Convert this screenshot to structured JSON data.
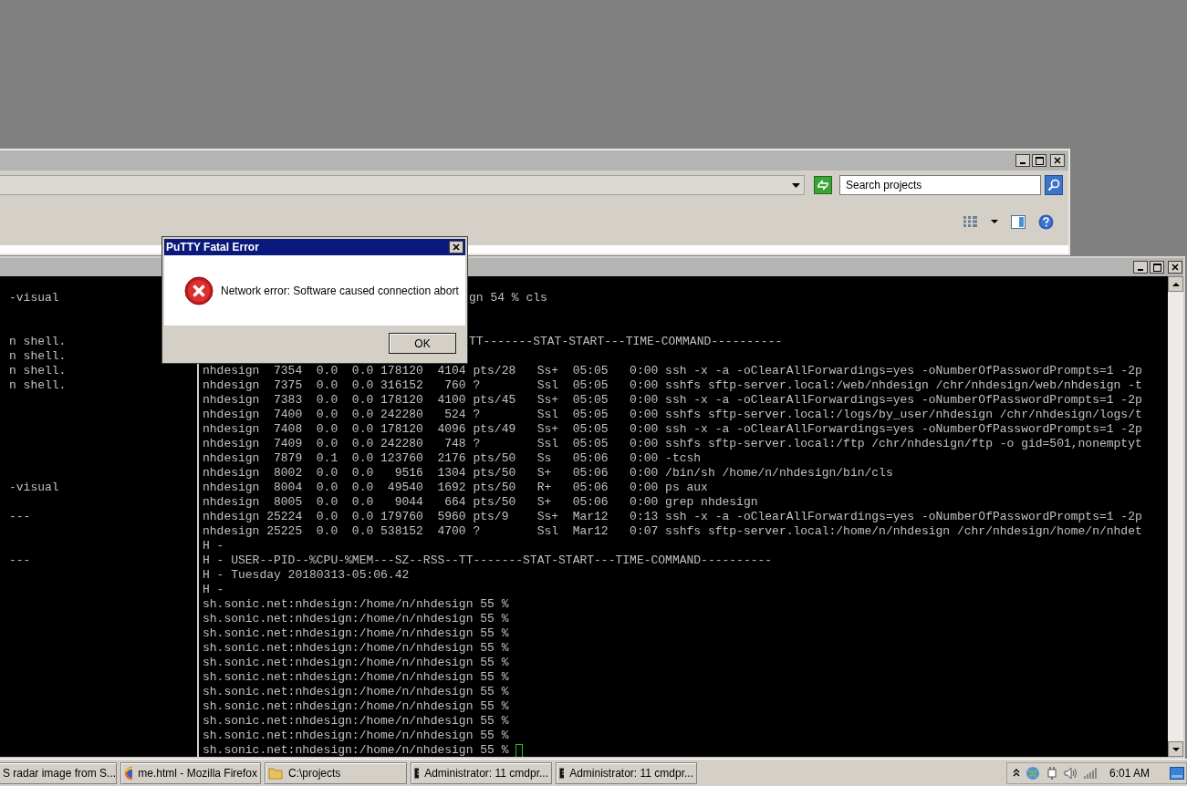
{
  "explorer_window": {
    "search": {
      "placeholder": "Search projects"
    }
  },
  "background_terminal": {
    "lines": [
      {
        "kind": "blank"
      },
      {
        "kind": "text",
        "text": "-visual"
      },
      {
        "kind": "blank"
      },
      {
        "kind": "blank"
      },
      {
        "kind": "text",
        "text": "n shell."
      },
      {
        "kind": "text",
        "text": "n shell."
      },
      {
        "kind": "text",
        "text": "n shell."
      },
      {
        "kind": "text",
        "text": "n shell."
      },
      {
        "kind": "blank"
      },
      {
        "kind": "blank"
      },
      {
        "kind": "blank"
      },
      {
        "kind": "blank"
      },
      {
        "kind": "blank"
      },
      {
        "kind": "blank"
      },
      {
        "kind": "text",
        "text": "-visual"
      },
      {
        "kind": "blank"
      },
      {
        "kind": "text",
        "text": "---"
      },
      {
        "kind": "blank"
      },
      {
        "kind": "blank"
      },
      {
        "kind": "text",
        "text": "---"
      }
    ]
  },
  "front_terminal": {
    "cursor": true,
    "lines": [
      {
        "kind": "blank"
      },
      {
        "kind": "partial",
        "text": "gn 54 % cls"
      },
      {
        "kind": "blank"
      },
      {
        "kind": "blank"
      },
      {
        "kind": "partial",
        "text": "TT-------STAT-START---TIME-COMMAND----------"
      },
      {
        "kind": "blank"
      },
      {
        "kind": "text",
        "text": "nhdesign  7354  0.0  0.0 178120  4104 pts/28   Ss+  05:05   0:00 ssh -x -a -oClearAllForwardings=yes -oNumberOfPasswordPrompts=1 -2p"
      },
      {
        "kind": "text",
        "text": "nhdesign  7375  0.0  0.0 316152   760 ?        Ssl  05:05   0:00 sshfs sftp-server.local:/web/nhdesign /chr/nhdesign/web/nhdesign -t"
      },
      {
        "kind": "text",
        "text": "nhdesign  7383  0.0  0.0 178120  4100 pts/45   Ss+  05:05   0:00 ssh -x -a -oClearAllForwardings=yes -oNumberOfPasswordPrompts=1 -2p"
      },
      {
        "kind": "text",
        "text": "nhdesign  7400  0.0  0.0 242280   524 ?        Ssl  05:05   0:00 sshfs sftp-server.local:/logs/by_user/nhdesign /chr/nhdesign/logs/t"
      },
      {
        "kind": "text",
        "text": "nhdesign  7408  0.0  0.0 178120  4096 pts/49   Ss+  05:05   0:00 ssh -x -a -oClearAllForwardings=yes -oNumberOfPasswordPrompts=1 -2p"
      },
      {
        "kind": "text",
        "text": "nhdesign  7409  0.0  0.0 242280   748 ?        Ssl  05:05   0:00 sshfs sftp-server.local:/ftp /chr/nhdesign/ftp -o gid=501,nonemptyt"
      },
      {
        "kind": "text",
        "text": "nhdesign  7879  0.1  0.0 123760  2176 pts/50   Ss   05:06   0:00 -tcsh"
      },
      {
        "kind": "text",
        "text": "nhdesign  8002  0.0  0.0   9516  1304 pts/50   S+   05:06   0:00 /bin/sh /home/n/nhdesign/bin/cls"
      },
      {
        "kind": "text",
        "text": "nhdesign  8004  0.0  0.0  49540  1692 pts/50   R+   05:06   0:00 ps aux"
      },
      {
        "kind": "text",
        "text": "nhdesign  8005  0.0  0.0   9044   664 pts/50   S+   05:06   0:00 grep nhdesign"
      },
      {
        "kind": "text",
        "text": "nhdesign 25224  0.0  0.0 179760  5960 pts/9    Ss+  Mar12   0:13 ssh -x -a -oClearAllForwardings=yes -oNumberOfPasswordPrompts=1 -2p"
      },
      {
        "kind": "text",
        "text": "nhdesign 25225  0.0  0.0 538152  4700 ?        Ssl  Mar12   0:07 sshfs sftp-server.local:/home/n/nhdesign /chr/nhdesign/home/n/nhdet"
      },
      {
        "kind": "text",
        "text": "H -"
      },
      {
        "kind": "text",
        "text": "H - USER--PID--%CPU-%MEM---SZ--RSS--TT-------STAT-START---TIME-COMMAND----------"
      },
      {
        "kind": "text",
        "text": "H - Tuesday 20180313-05:06.42"
      },
      {
        "kind": "text",
        "text": "H -"
      },
      {
        "kind": "text",
        "text": "sh.sonic.net:nhdesign:/home/n/nhdesign 55 %"
      },
      {
        "kind": "text",
        "text": "sh.sonic.net:nhdesign:/home/n/nhdesign 55 %"
      },
      {
        "kind": "text",
        "text": "sh.sonic.net:nhdesign:/home/n/nhdesign 55 %"
      },
      {
        "kind": "text",
        "text": "sh.sonic.net:nhdesign:/home/n/nhdesign 55 %"
      },
      {
        "kind": "text",
        "text": "sh.sonic.net:nhdesign:/home/n/nhdesign 55 %"
      },
      {
        "kind": "text",
        "text": "sh.sonic.net:nhdesign:/home/n/nhdesign 55 %"
      },
      {
        "kind": "text",
        "text": "sh.sonic.net:nhdesign:/home/n/nhdesign 55 %"
      },
      {
        "kind": "text",
        "text": "sh.sonic.net:nhdesign:/home/n/nhdesign 55 %"
      },
      {
        "kind": "text",
        "text": "sh.sonic.net:nhdesign:/home/n/nhdesign 55 %"
      },
      {
        "kind": "text",
        "text": "sh.sonic.net:nhdesign:/home/n/nhdesign 55 %"
      },
      {
        "kind": "text",
        "text": "sh.sonic.net:nhdesign:/home/n/nhdesign 55 %"
      }
    ]
  },
  "error_dialog": {
    "title": "PuTTY Fatal Error",
    "message": "Network error: Software caused connection abort",
    "buttons": [
      "OK"
    ]
  },
  "taskbar": {
    "items": [
      {
        "kind": "plain",
        "label": "S radar image from S..."
      },
      {
        "kind": "browser",
        "label": "me.html - Mozilla Firefox"
      },
      {
        "kind": "folder",
        "label": "C:\\projects"
      },
      {
        "kind": "console",
        "label": "Administrator: 11 cmdpr..."
      },
      {
        "kind": "console",
        "label": "Administrator: 11 cmdpr..."
      }
    ],
    "clock": "6:01 AM"
  }
}
